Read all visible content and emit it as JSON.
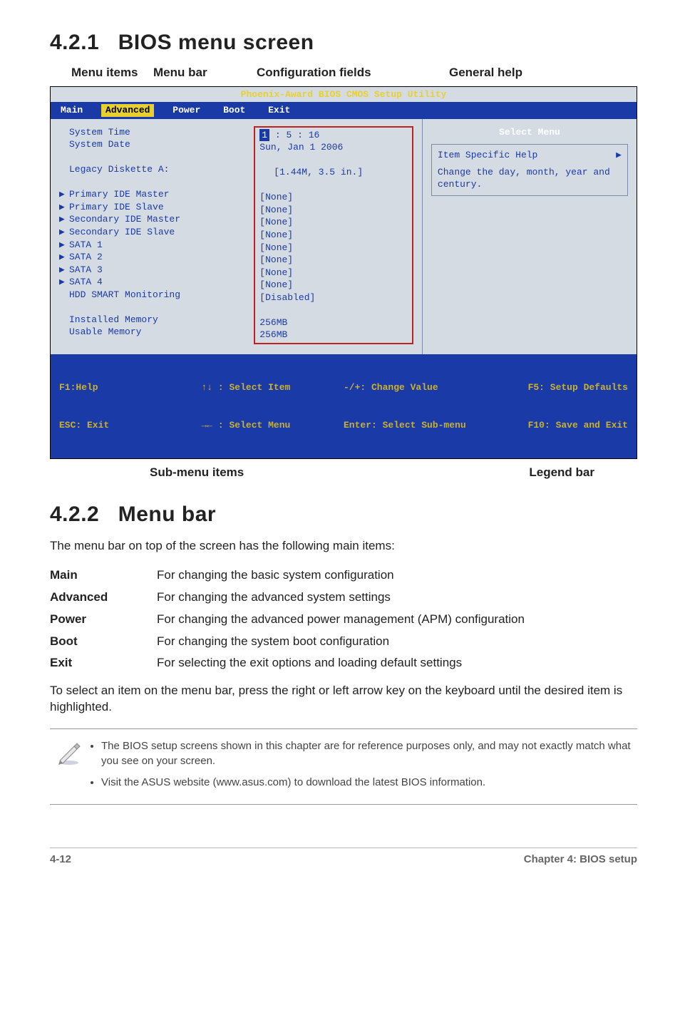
{
  "sections": {
    "s1_num": "4.2.1",
    "s1_title": "BIOS menu screen",
    "s2_num": "4.2.2",
    "s2_title": "Menu bar"
  },
  "top_labels": {
    "menu_items": "Menu items",
    "menu_bar": "Menu bar",
    "config_fields": "Configuration fields",
    "general_help": "General help"
  },
  "bios": {
    "title": "Phoenix-Award BIOS CMOS Setup Utility",
    "tabs": {
      "main": "Main",
      "advanced": "Advanced",
      "power": "Power",
      "boot": "Boot",
      "exit": "Exit"
    },
    "rows": {
      "system_time_l": "System Time",
      "system_time_v_prefix": "1",
      "system_time_v_rest": " : 5 : 16",
      "system_date_l": "System Date",
      "system_date_v": "Sun, Jan 1 2006",
      "legacy_l": "Legacy Diskette A:",
      "legacy_v": "[1.44M, 3.5 in.]",
      "pim_l": "Primary IDE Master",
      "pim_v": "[None]",
      "pis_l": "Primary IDE Slave",
      "pis_v": "[None]",
      "sim_l": "Secondary IDE Master",
      "sim_v": "[None]",
      "sis_l": "Secondary IDE Slave",
      "sis_v": "[None]",
      "s1_l": "SATA 1",
      "s1_v": "[None]",
      "s2_l": "SATA 2",
      "s2_v": "[None]",
      "s3_l": "SATA 3",
      "s3_v": "[None]",
      "s4_l": "SATA 4",
      "s4_v": "[None]",
      "hdd_l": "HDD SMART Monitoring",
      "hdd_v": "[Disabled]",
      "inst_l": "Installed Memory",
      "inst_v": "256MB",
      "use_l": "Usable Memory",
      "use_v": "256MB"
    },
    "right": {
      "head": "Select Menu",
      "item_help": "Item Specific Help",
      "body": "Change the day, month, year and century."
    },
    "foot": {
      "c1a": "F1:Help",
      "c1b": "ESC: Exit",
      "c2a": "↑↓ : Select Item",
      "c2b": "→← : Select Menu",
      "c3a": "-/+: Change Value",
      "c3b": "Enter: Select Sub-menu",
      "c4a": "F5: Setup Defaults",
      "c4b": "F10: Save and Exit"
    }
  },
  "under_labels": {
    "sub": "Sub-menu items",
    "legend": "Legend bar"
  },
  "menu_intro": "The menu bar on top of the screen has the following main items:",
  "defs": {
    "main_t": "Main",
    "main_d": "For changing the basic system configuration",
    "adv_t": "Advanced",
    "adv_d": "For changing the advanced system settings",
    "pow_t": "Power",
    "pow_d": "For changing the advanced power management (APM) configuration",
    "boot_t": "Boot",
    "boot_d": "For changing the system boot configuration",
    "exit_t": "Exit",
    "exit_d": "For selecting the exit options and loading default settings"
  },
  "select_para": "To select an item on the menu bar, press the right or left arrow key on the keyboard until the desired item is highlighted.",
  "notes": {
    "n1": "The BIOS setup screens shown in this chapter are for reference purposes only, and may not exactly match what you see on your screen.",
    "n2": "Visit the ASUS website (www.asus.com) to download the latest BIOS information."
  },
  "footer": {
    "page": "4-12",
    "chapter": "Chapter 4: BIOS setup"
  }
}
